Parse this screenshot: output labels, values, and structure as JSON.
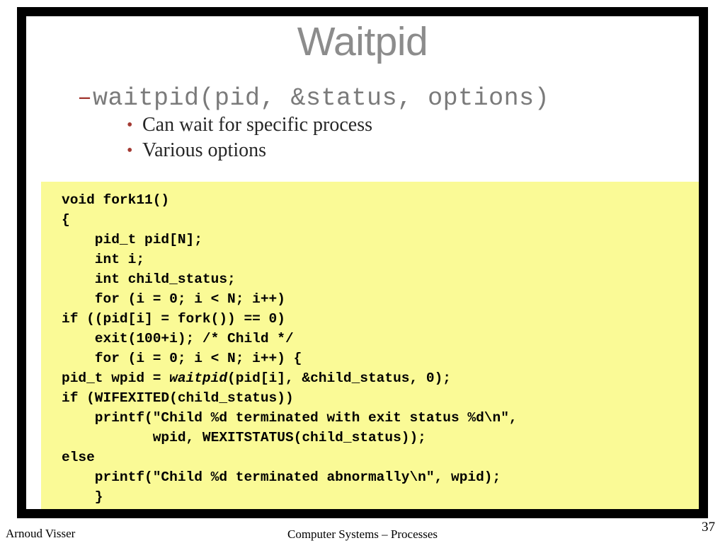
{
  "slide": {
    "title": "Waitpid",
    "colors": {
      "title": "#8c8c8c",
      "accent_red": "#a33a33",
      "code_background": "#fafa96",
      "frame": "#000000",
      "body_text": "#262626",
      "signature_text": "#7a7a7a"
    },
    "bullets": [
      {
        "level": 1,
        "marker": "dash-marker",
        "marker_glyph": "–",
        "text": "waitpid(pid, &status, options)"
      },
      {
        "level": 2,
        "marker": "bullet-dot",
        "marker_glyph": "•",
        "text": "Can wait for specific process"
      },
      {
        "level": 2,
        "marker": "bullet-dot",
        "marker_glyph": "•",
        "text": "Various options"
      }
    ],
    "code": {
      "language": "c",
      "lines": [
        [
          {
            "t": "void fork11()",
            "i": false
          }
        ],
        [
          {
            "t": "{",
            "i": false
          }
        ],
        [
          {
            "t": "    pid_t pid[N];",
            "i": false
          }
        ],
        [
          {
            "t": "    int i;",
            "i": false
          }
        ],
        [
          {
            "t": "    int child_status;",
            "i": false
          }
        ],
        [
          {
            "t": "    for (i = 0; i < N; i++)",
            "i": false
          }
        ],
        [
          {
            "t": "if ((pid[i] = fork()) == 0)",
            "i": false
          }
        ],
        [
          {
            "t": "    exit(100+i); /* Child */",
            "i": false
          }
        ],
        [
          {
            "t": "    for (i = 0; i < N; i++) {",
            "i": false
          }
        ],
        [
          {
            "t": "pid_t wpid = ",
            "i": false
          },
          {
            "t": "waitpid",
            "i": true
          },
          {
            "t": "(pid[i], &child_status, 0);",
            "i": false
          }
        ],
        [
          {
            "t": "if (WIFEXITED(child_status))",
            "i": false
          }
        ],
        [
          {
            "t": "    printf(\"Child %d terminated with exit status %d\\n\",",
            "i": false
          }
        ],
        [
          {
            "t": "           wpid, WEXITSTATUS(child_status));",
            "i": false
          }
        ],
        [
          {
            "t": "else",
            "i": false
          }
        ],
        [
          {
            "t": "    printf(\"Child %d terminated abnormally\\n\", wpid);",
            "i": false
          }
        ],
        [
          {
            "t": "    }",
            "i": false
          }
        ],
        [
          {
            "t": "}",
            "i": false
          }
        ]
      ]
    }
  },
  "footer": {
    "author": "Arnoud Visser",
    "center": "Computer Systems – Processes",
    "page_number": "37"
  }
}
